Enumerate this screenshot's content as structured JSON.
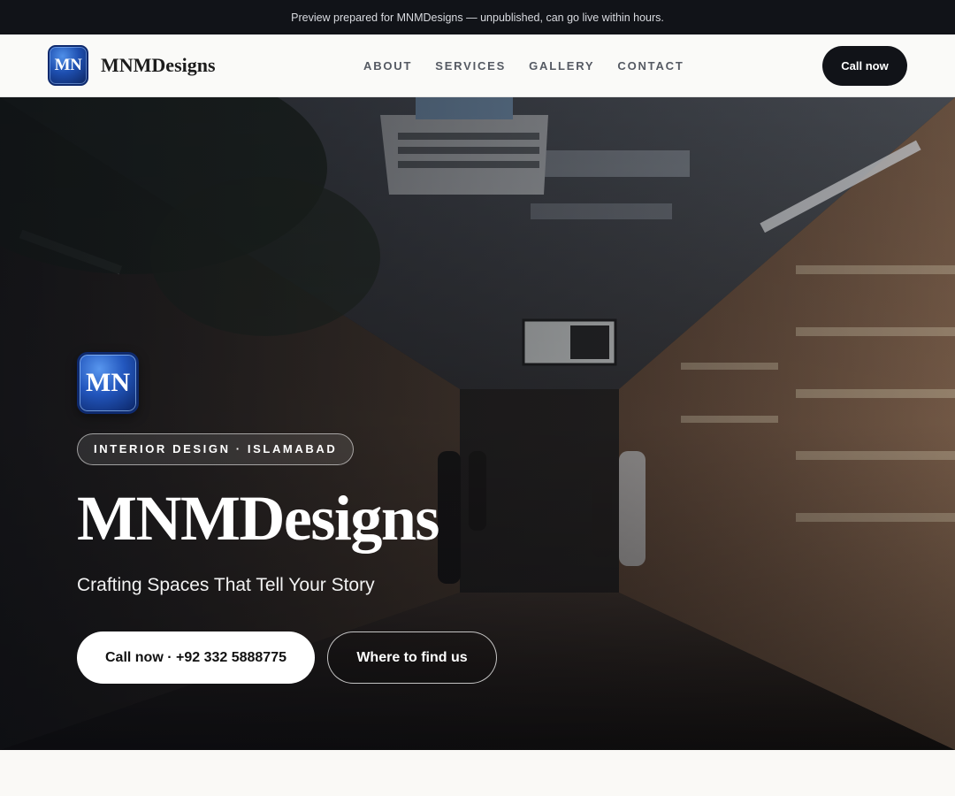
{
  "preview_bar": {
    "text": "Preview prepared for MNMDesigns — unpublished, can go live within hours."
  },
  "nav": {
    "logo_text": "MN",
    "brand_name": "MNMDesigns",
    "links": [
      "ABOUT",
      "SERVICES",
      "GALLERY",
      "CONTACT"
    ],
    "cta_label": "Call now"
  },
  "hero": {
    "logo_text": "MN",
    "pill": "INTERIOR DESIGN · ISLAMABAD",
    "title": "MNMDesigns",
    "subtitle": "Crafting Spaces That Tell Your Story",
    "primary_button": "Call now · +92 332 5888775",
    "secondary_button": "Where to find us"
  },
  "colors": {
    "dark": "#111318",
    "brand_blue": "#1e4fb0",
    "page_bg": "#faf9f6"
  }
}
